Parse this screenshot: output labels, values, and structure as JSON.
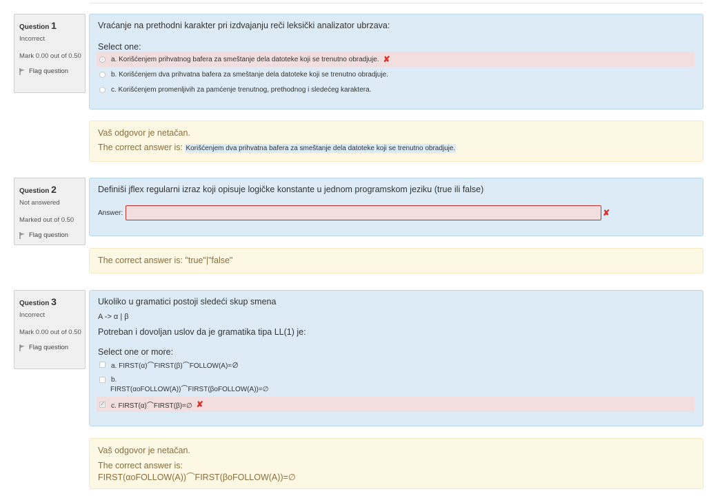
{
  "questions": [
    {
      "label": "Question",
      "number": "1",
      "state": "Incorrect",
      "grade": "Mark 0.00 out of 0.50",
      "flag": "Flag question",
      "text": "Vraćanje na prethodni karakter pri izdvajanju reči leksički analizator ubrzava:",
      "prompt": "Select one:",
      "options": [
        "a. Korišćenjem prihvatnog bafera za smeštanje dela datoteke koji se trenutno obradjuje.",
        "b. Korišćenjem dva prihvatna bafera za smeštanje dela datoteke koji se trenutno obradjuje.",
        "c. Korišćenjem promenljivih za pamćenje trenutnog, prethodnog i sledećeg karaktera."
      ],
      "feedback_line": "Vaš odgovor je netačan.",
      "correct_label": "The correct answer is:",
      "correct_answer": "Korišćenjem dva prihvatna bafera za smeštanje dela datoteke koji se trenutno obradjuje."
    },
    {
      "label": "Question",
      "number": "2",
      "state": "Not answered",
      "grade": "Marked out of 0.50",
      "flag": "Flag question",
      "text": "Definiši jflex regularni izraz koji opisuje logičke konstante u jednom programskom jeziku (true ili false)",
      "answer_label": "Answer:",
      "answer_value": "",
      "correct_answer": "The correct answer is: \"true\"|\"false\""
    },
    {
      "label": "Question",
      "number": "3",
      "state": "Incorrect",
      "grade": "Mark 0.00 out of 0.50",
      "flag": "Flag question",
      "text1": "Ukoliko u gramatici postoji sledeći skup smena",
      "text2": "A -> α | β",
      "text3": "Potreban i dovoljan uslov da je gramatika tipa LL(1) je:",
      "prompt": "Select one or more:",
      "options": [
        "a. FIRST(α)⌒FIRST(β)⌒FOLLOW(A)=∅",
        "b.",
        "FIRST(αoFOLLOW(A))⌒FIRST(βoFOLLOW(A))=∅",
        "c. FIRST(α)⌒FIRST(β)=∅"
      ],
      "feedback_line": "Vaš odgovor je netačan.",
      "correct_label": "The correct answer is:",
      "correct_answer": "FIRST(αoFOLLOW(A))⌒FIRST(βoFOLLOW(A))=∅"
    }
  ],
  "colors": {
    "incorrect": "#d9302c",
    "formulation_bg": "#dcebf5",
    "feedback_bg": "#fcf8e3"
  }
}
